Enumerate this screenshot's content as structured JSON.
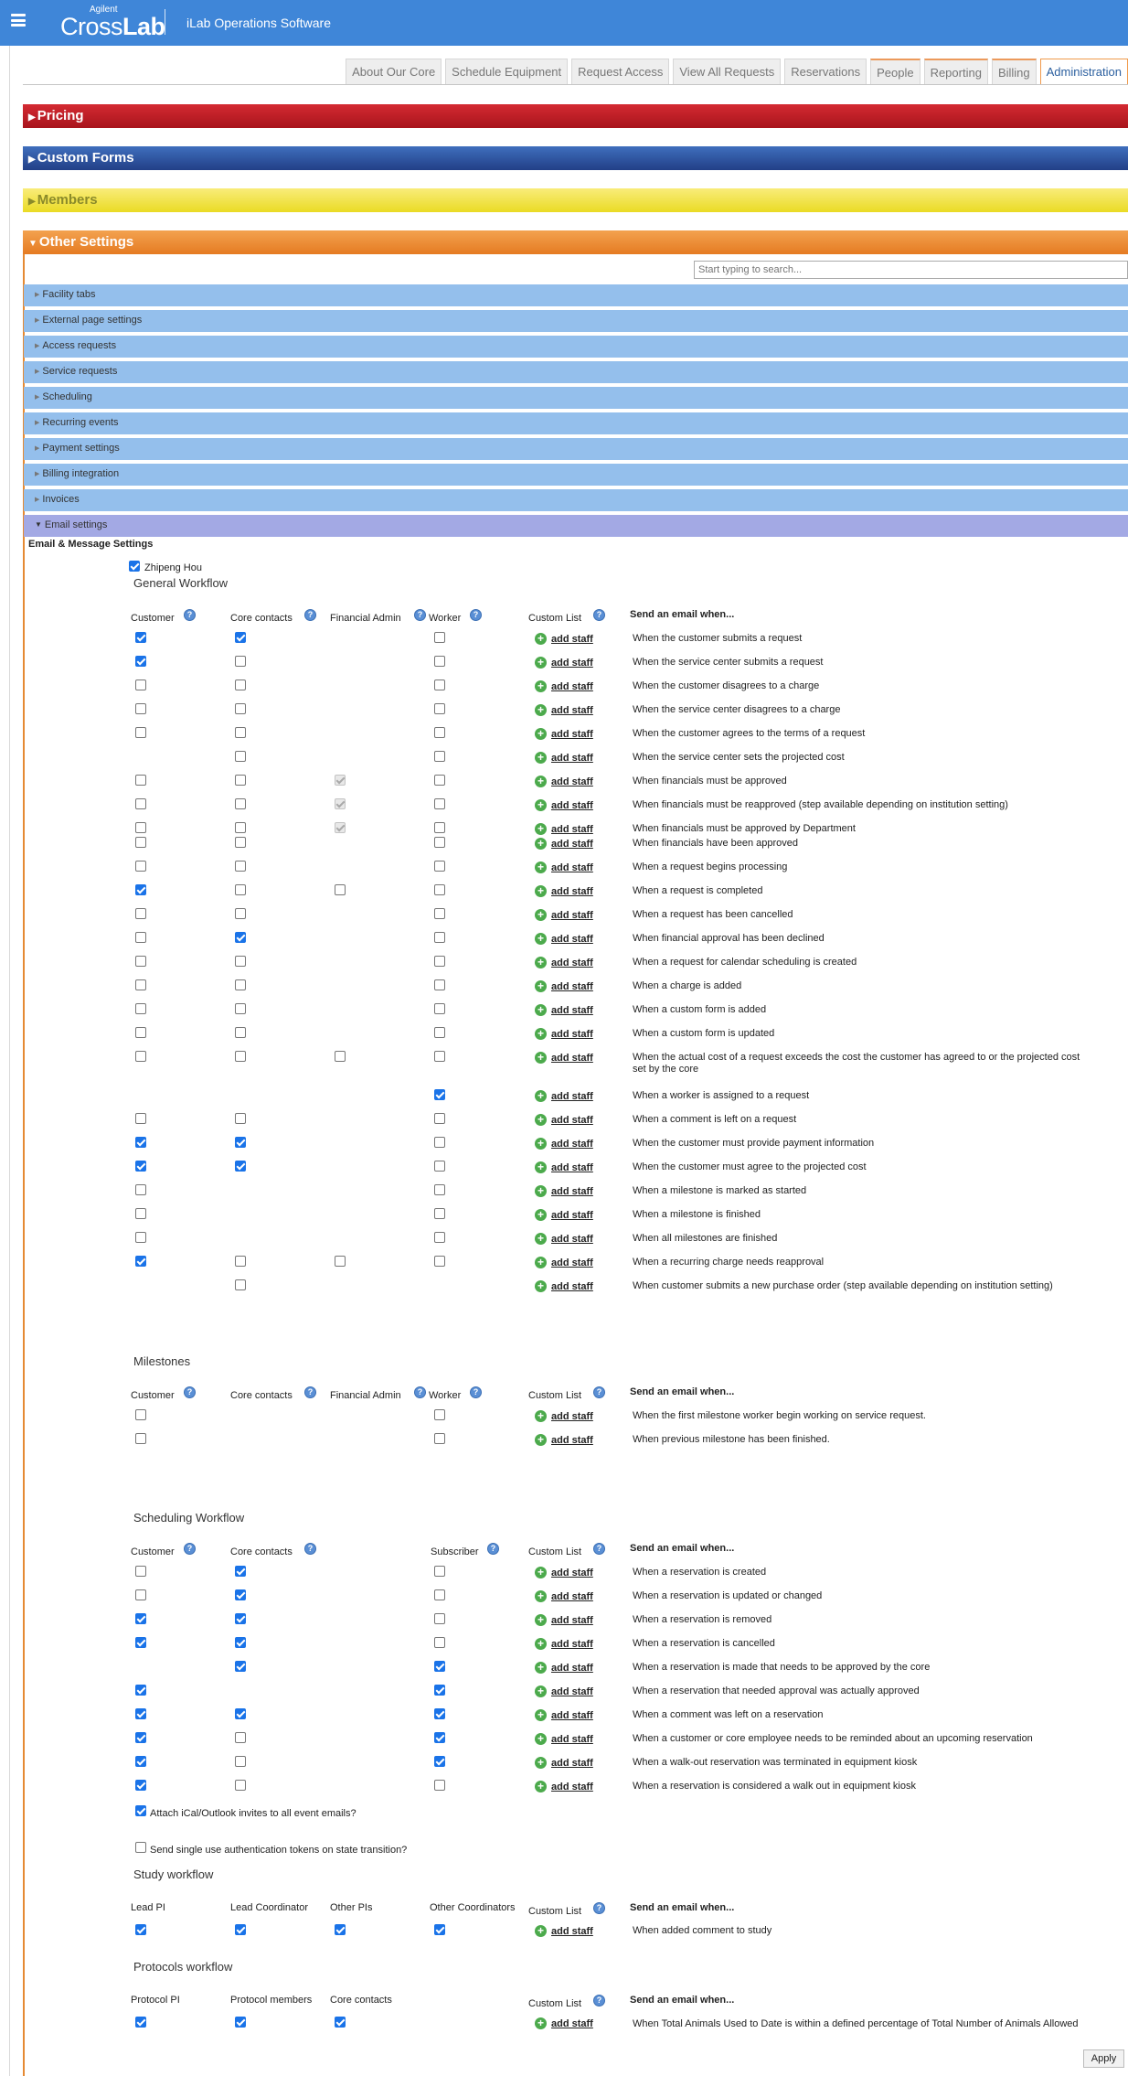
{
  "header": {
    "logo_small": "Agilent",
    "logo_part1": "Cross",
    "logo_part2": "Lab",
    "app_name": "iLab Operations Software"
  },
  "nav_tabs": [
    "About Our Core",
    "Schedule Equipment",
    "Request Access",
    "View All Requests",
    "Reservations",
    "People",
    "Reporting",
    "Billing",
    "Administration"
  ],
  "sections": {
    "pricing": "Pricing",
    "custom_forms": "Custom Forms",
    "members": "Members",
    "other": "Other Settings"
  },
  "search": {
    "placeholder": "Start typing to search..."
  },
  "subsections": [
    "Facility tabs",
    "External page settings",
    "Access requests",
    "Service requests",
    "Scheduling",
    "Recurring events",
    "Payment settings",
    "Billing integration",
    "Invoices",
    "Email settings"
  ],
  "email": {
    "title": "Email & Message Settings",
    "user": "Zhipeng Hou",
    "add_staff": "add staff",
    "send_when": "Send an email when...",
    "general": {
      "title": "General Workflow",
      "headers": [
        "Customer",
        "Core contacts",
        "Financial Admin",
        "Worker",
        "Custom List"
      ],
      "rows": [
        {
          "c": 1,
          "cc": 1,
          "fa": null,
          "w": 0,
          "t": "When the customer submits a request"
        },
        {
          "c": 1,
          "cc": 0,
          "fa": null,
          "w": 0,
          "t": "When the service center submits a request"
        },
        {
          "c": 0,
          "cc": 0,
          "fa": null,
          "w": 0,
          "t": "When the customer disagrees to a charge"
        },
        {
          "c": 0,
          "cc": 0,
          "fa": null,
          "w": 0,
          "t": "When the service center disagrees to a charge"
        },
        {
          "c": 0,
          "cc": 0,
          "fa": null,
          "w": 0,
          "t": "When the customer agrees to the terms of a request"
        },
        {
          "c": null,
          "cc": 0,
          "fa": null,
          "w": 0,
          "t": "When the service center sets the projected cost"
        },
        {
          "c": 0,
          "cc": 0,
          "fa": "d",
          "w": 0,
          "t": "When financials must be approved"
        },
        {
          "c": 0,
          "cc": 0,
          "fa": "d",
          "w": 0,
          "t": "When financials must be reapproved (step available depending on institution setting)"
        },
        {
          "c": 0,
          "cc": 0,
          "fa": "d",
          "w": 0,
          "t": "When financials must be approved by Department"
        },
        {
          "c": 0,
          "cc": 0,
          "fa": null,
          "w": 0,
          "t": "When financials have been approved"
        },
        {
          "c": 0,
          "cc": 0,
          "fa": null,
          "w": 0,
          "t": "When a request begins processing"
        },
        {
          "c": 1,
          "cc": 0,
          "fa": 0,
          "w": 0,
          "t": "When a request is completed"
        },
        {
          "c": 0,
          "cc": 0,
          "fa": null,
          "w": 0,
          "t": "When a request has been cancelled"
        },
        {
          "c": 0,
          "cc": 1,
          "fa": null,
          "w": 0,
          "t": "When financial approval has been declined"
        },
        {
          "c": 0,
          "cc": 0,
          "fa": null,
          "w": 0,
          "t": "When a request for calendar scheduling is created"
        },
        {
          "c": 0,
          "cc": 0,
          "fa": null,
          "w": 0,
          "t": "When a charge is added"
        },
        {
          "c": 0,
          "cc": 0,
          "fa": null,
          "w": 0,
          "t": "When a custom form is added"
        },
        {
          "c": 0,
          "cc": 0,
          "fa": null,
          "w": 0,
          "t": "When a custom form is updated"
        },
        {
          "c": 0,
          "cc": 0,
          "fa": 0,
          "w": 0,
          "t": "When the actual cost of a request exceeds the cost the customer has agreed to or the projected cost",
          "t2": "set by the core"
        },
        {
          "c": null,
          "cc": null,
          "fa": null,
          "w": 1,
          "t": "When a worker is assigned to a request"
        },
        {
          "c": 0,
          "cc": 0,
          "fa": null,
          "w": 0,
          "t": "When a comment is left on a request"
        },
        {
          "c": 1,
          "cc": 1,
          "fa": null,
          "w": 0,
          "t": "When the customer must provide payment information"
        },
        {
          "c": 1,
          "cc": 1,
          "fa": null,
          "w": 0,
          "t": "When the customer must agree to the projected cost"
        },
        {
          "c": 0,
          "cc": null,
          "fa": null,
          "w": 0,
          "t": "When a milestone is marked as started"
        },
        {
          "c": 0,
          "cc": null,
          "fa": null,
          "w": 0,
          "t": "When a milestone is finished"
        },
        {
          "c": 0,
          "cc": null,
          "fa": null,
          "w": 0,
          "t": "When all milestones are finished"
        },
        {
          "c": 1,
          "cc": 0,
          "fa": 0,
          "w": 0,
          "t": "When a recurring charge needs reapproval"
        },
        {
          "c": null,
          "cc": 0,
          "fa": null,
          "w": null,
          "t": "When customer submits a new purchase order (step available depending on institution setting)"
        }
      ]
    },
    "milestones": {
      "title": "Milestones",
      "headers": [
        "Customer",
        "Core contacts",
        "Financial Admin",
        "Worker",
        "Custom List"
      ],
      "rows": [
        {
          "c": 0,
          "w": 0,
          "t": "When the first milestone worker begin working on service request."
        },
        {
          "c": 0,
          "w": 0,
          "t": "When previous milestone has been finished."
        }
      ]
    },
    "scheduling": {
      "title": "Scheduling Workflow",
      "headers": [
        "Customer",
        "Core contacts",
        "Subscriber",
        "Custom List"
      ],
      "rows": [
        {
          "c": 0,
          "cc": 1,
          "s": 0,
          "t": "When a reservation is created"
        },
        {
          "c": 0,
          "cc": 1,
          "s": 0,
          "t": "When a reservation is updated or changed"
        },
        {
          "c": 1,
          "cc": 1,
          "s": 0,
          "t": "When a reservation is removed"
        },
        {
          "c": 1,
          "cc": 1,
          "s": 0,
          "t": "When a reservation is cancelled"
        },
        {
          "c": null,
          "cc": 1,
          "s": 1,
          "t": "When a reservation is made that needs to be approved by the core"
        },
        {
          "c": 1,
          "cc": null,
          "s": 1,
          "t": "When a reservation that needed approval was actually approved"
        },
        {
          "c": 1,
          "cc": 1,
          "s": 1,
          "t": "When a comment was left on a reservation"
        },
        {
          "c": 1,
          "cc": 0,
          "s": 1,
          "t": "When a customer or core employee needs to be reminded about an upcoming reservation"
        },
        {
          "c": 1,
          "cc": 0,
          "s": 1,
          "t": "When a walk-out reservation was terminated in equipment kiosk"
        },
        {
          "c": 1,
          "cc": 0,
          "s": 0,
          "t": "When a reservation is considered a walk out in equipment kiosk"
        }
      ],
      "ical_label": "Attach iCal/Outlook invites to all event emails?",
      "token_label": "Send single use authentication tokens on state transition?"
    },
    "study": {
      "title": "Study workflow",
      "headers": [
        "Lead PI",
        "Lead Coordinator",
        "Other PIs",
        "Other Coordinators",
        "Custom List"
      ],
      "row": "When added comment to study"
    },
    "protocols": {
      "title": "Protocols workflow",
      "headers": [
        "Protocol PI",
        "Protocol members",
        "Core contacts",
        "Custom List"
      ],
      "row": "When Total Animals Used to Date is within a defined percentage of Total Number of Animals Allowed"
    }
  },
  "apply_label": "Apply"
}
